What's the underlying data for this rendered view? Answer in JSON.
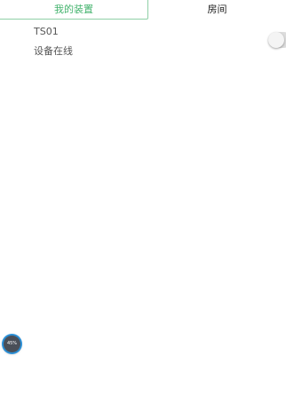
{
  "tabs": {
    "my_devices": "我的装置",
    "rooms": "房间"
  },
  "device": {
    "name": "TS01",
    "status": "设备在线",
    "switch_on": false
  },
  "floating_widget": {
    "label": "45%"
  },
  "colors": {
    "accent": "#43b36d",
    "tab_border": "#8fd0a6",
    "text": "#555555"
  }
}
